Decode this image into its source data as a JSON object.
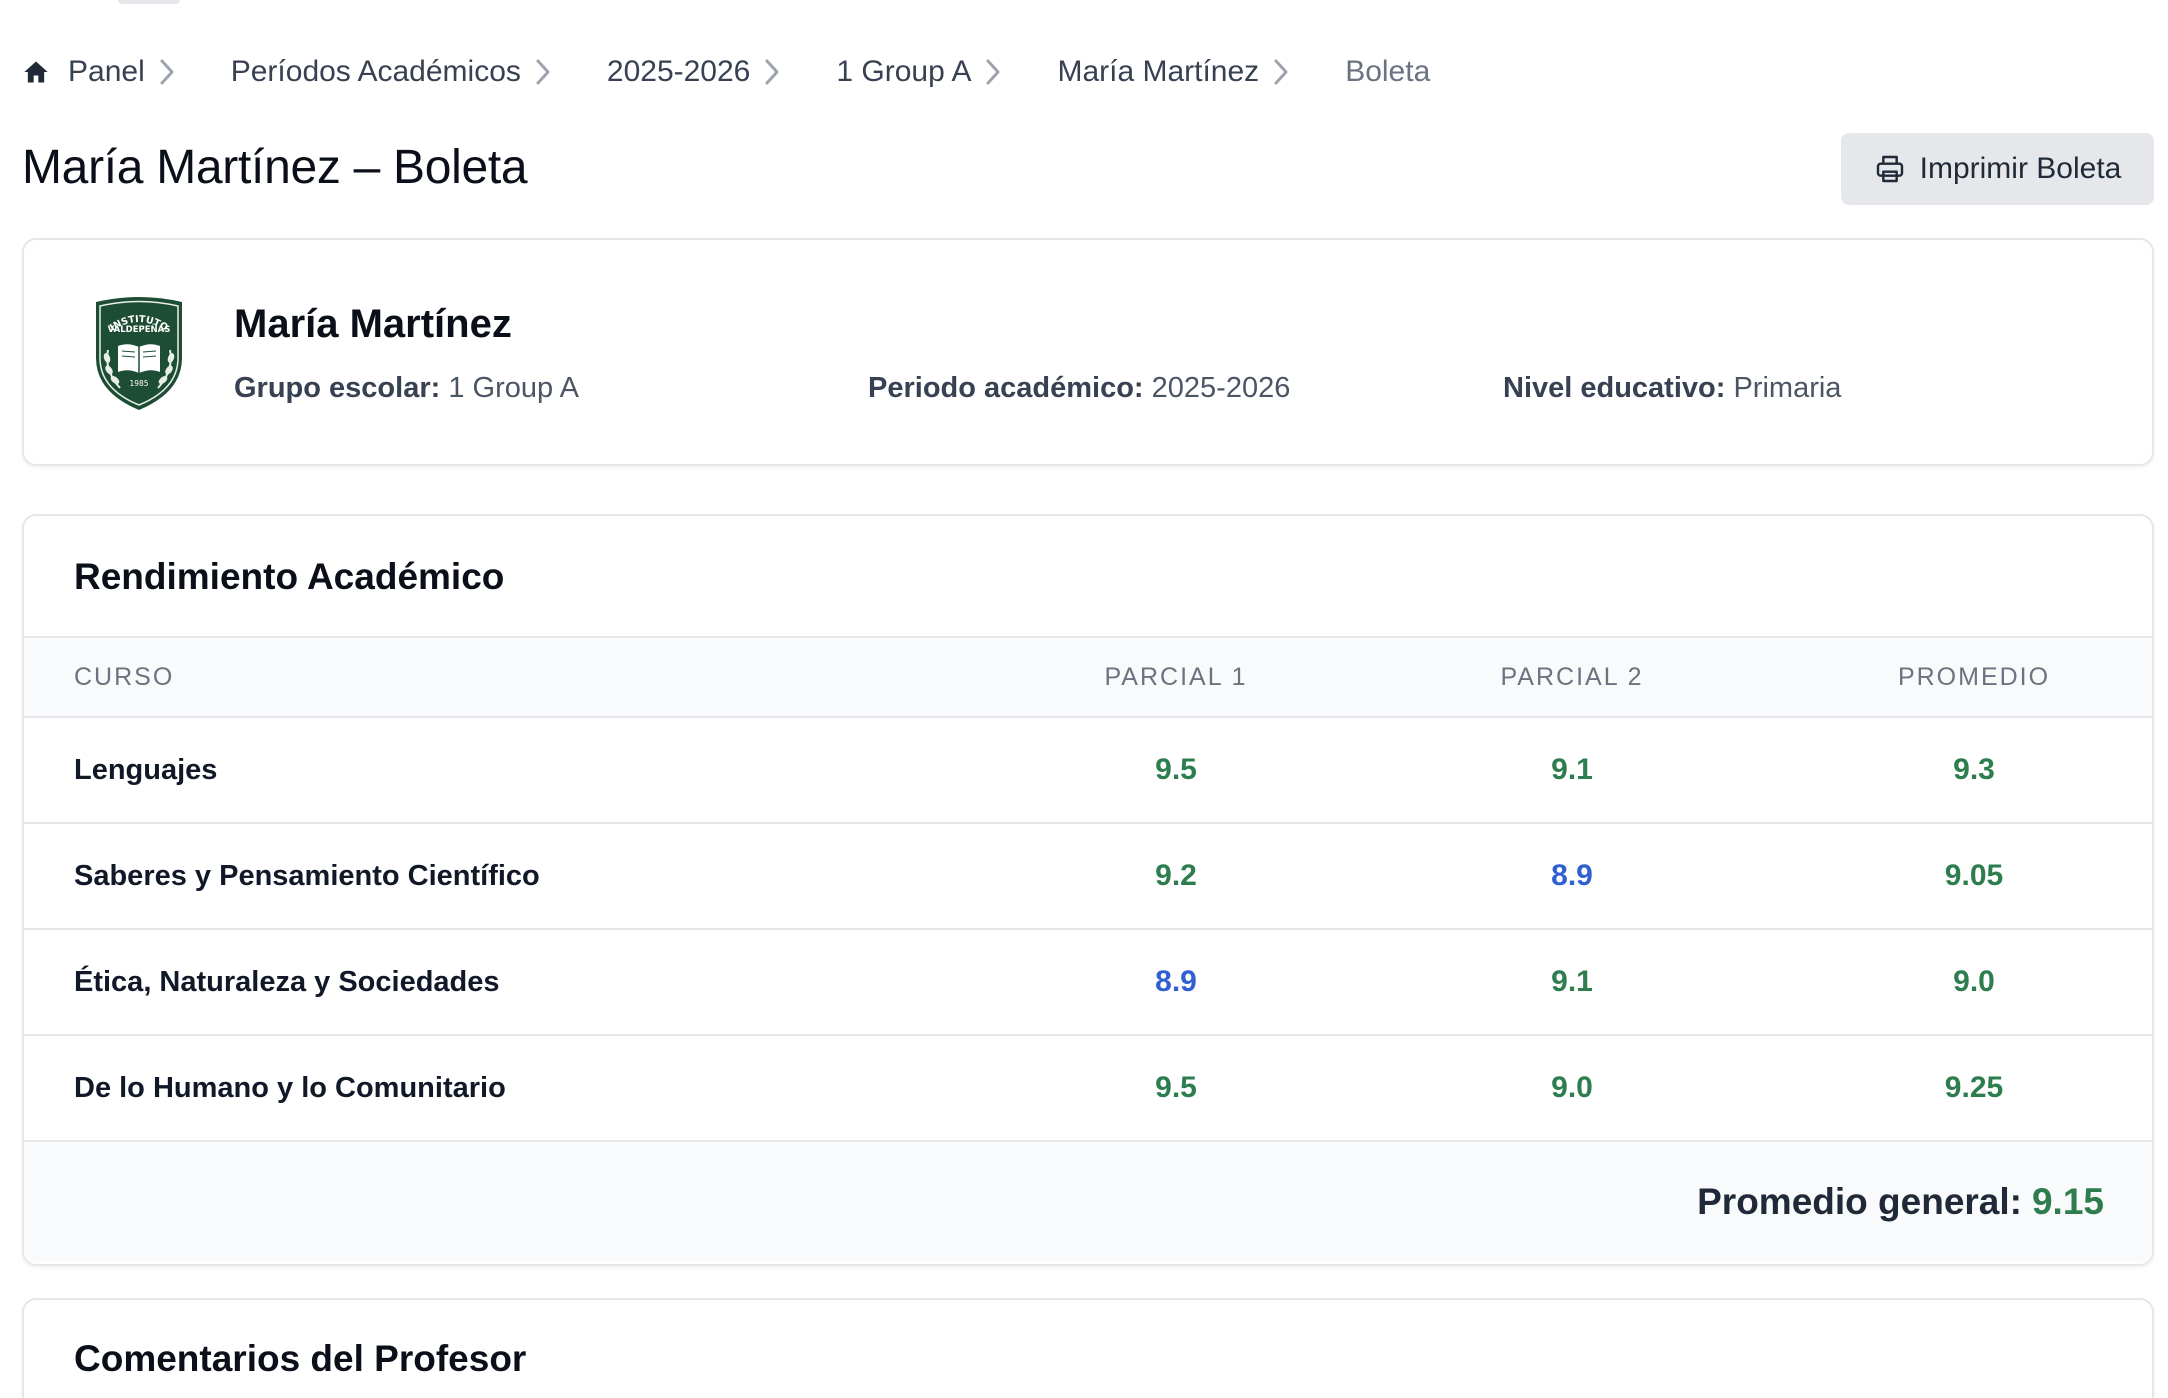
{
  "breadcrumb": {
    "items": [
      {
        "label": "Panel",
        "icon": "home-icon"
      },
      {
        "label": "Períodos Académicos"
      },
      {
        "label": "2025-2026"
      },
      {
        "label": "1 Group A"
      },
      {
        "label": "María Martínez"
      }
    ],
    "current": "Boleta"
  },
  "page": {
    "title": "María Martínez – Boleta",
    "print_label": "Imprimir Boleta"
  },
  "student": {
    "name": "María Martínez",
    "group_label": "Grupo escolar:",
    "group_value": "1 Group A",
    "period_label": "Periodo académico:",
    "period_value": "2025-2026",
    "level_label": "Nivel educativo:",
    "level_value": "Primaria",
    "crest": {
      "top_text": "INSTITUTO",
      "mid_text": "VALDEPEÑAS",
      "year": "1985",
      "color": "#1e4d35"
    }
  },
  "performance": {
    "title": "Rendimiento Académico",
    "headers": {
      "course": "CURSO",
      "p1": "PARCIAL 1",
      "p2": "PARCIAL 2",
      "avg": "PROMEDIO"
    },
    "rows": [
      {
        "course": "Lenguajes",
        "p1": "9.5",
        "p2": "9.1",
        "avg": "9.3"
      },
      {
        "course": "Saberes y Pensamiento Científico",
        "p1": "9.2",
        "p2": "8.9",
        "avg": "9.05"
      },
      {
        "course": "Ética, Naturaleza y Sociedades",
        "p1": "8.9",
        "p2": "9.1",
        "avg": "9.0"
      },
      {
        "course": "De lo Humano y lo Comunitario",
        "p1": "9.5",
        "p2": "9.0",
        "avg": "9.25"
      }
    ],
    "overall_label": "Promedio general:",
    "overall_value": "9.15",
    "colors": {
      "high": "#2e7d4f",
      "mid": "#2f5fd1"
    }
  },
  "comments": {
    "title": "Comentarios del Profesor"
  }
}
